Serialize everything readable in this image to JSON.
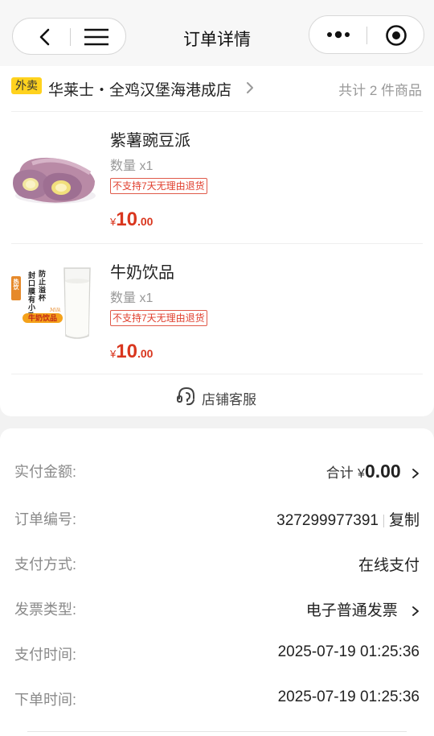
{
  "nav": {
    "title": "订单详情"
  },
  "shop": {
    "badge": "外卖",
    "name": "华莱士・全鸡汉堡海港成店",
    "item_count": "共计 2 件商品"
  },
  "items": [
    {
      "name": "紫薯豌豆派",
      "qty": "数量 x1",
      "tag": "不支持7天无理由退货",
      "currency": "¥",
      "price_int": "10",
      "price_dec": ".00"
    },
    {
      "name": "牛奶饮品",
      "qty": "数量 x1",
      "tag": "不支持7天无理由退货",
      "currency": "¥",
      "price_int": "10",
      "price_dec": ".00",
      "image_text": {
        "hot": "热饮",
        "col1": "封口膜有小孔",
        "col2": "防止溢杯",
        "banner": "牛奶饮品",
        "script": "Milk"
      }
    }
  ],
  "service": {
    "label": "店铺客服"
  },
  "details": {
    "paid_label": "实付金额:",
    "total_prefix": "合计",
    "currency": "¥",
    "total": "0.00",
    "order_no_label": "订单编号:",
    "order_no": "327299977391",
    "copy": "复制",
    "pay_method_label": "支付方式:",
    "pay_method": "在线支付",
    "invoice_label": "发票类型:",
    "invoice": "电子普通发票",
    "pay_time_label": "支付时间:",
    "pay_time": "2025-07-19 01:25:36",
    "order_time_label": "下单时间:",
    "order_time": "2025-07-19 01:25:36"
  },
  "colors": {
    "accent_price": "#d9361e",
    "badge_bg": "#ffd21e",
    "tag_border": "#e05a4a"
  },
  "icons": [
    "back-icon",
    "menu-icon",
    "more-icon",
    "target-icon",
    "chevron-right-icon",
    "headset-icon"
  ]
}
